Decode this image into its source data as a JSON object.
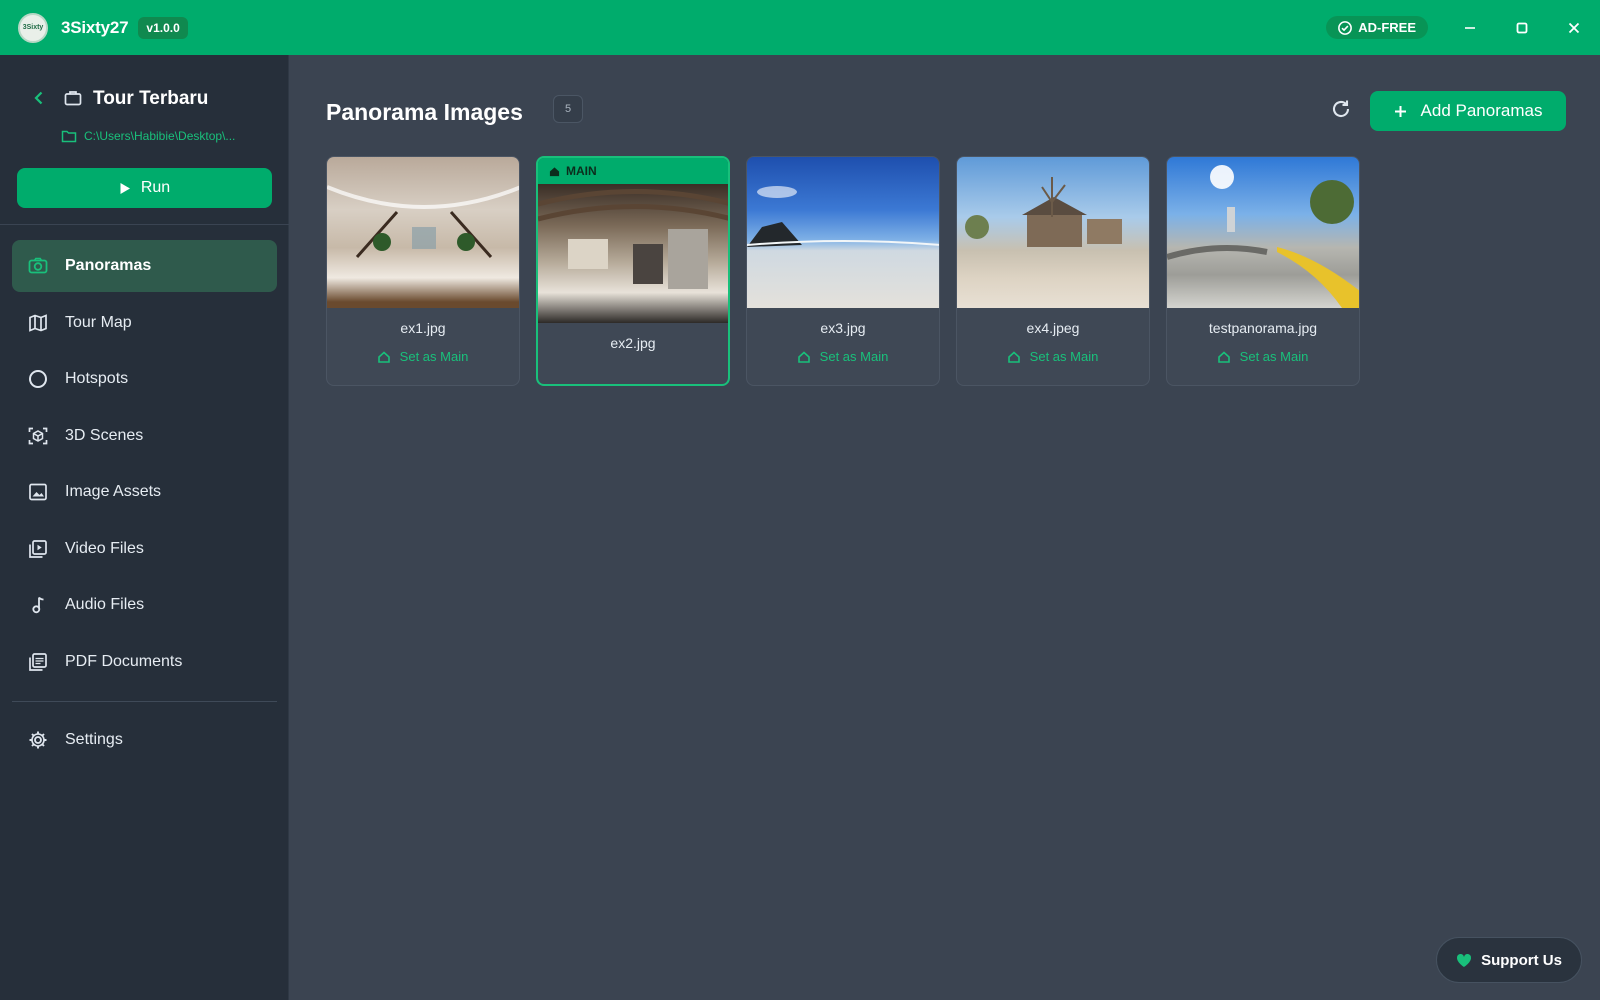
{
  "titlebar": {
    "app_name": "3Sixty27",
    "logo_text": "3Sixty",
    "version": "v1.0.0",
    "adfree_label": "AD-FREE"
  },
  "project": {
    "title": "Tour Terbaru",
    "path": "C:\\Users\\Habibie\\Desktop\\...",
    "run_label": "Run"
  },
  "nav": {
    "items": [
      {
        "label": "Panoramas",
        "icon": "camera-icon",
        "active": true
      },
      {
        "label": "Tour Map",
        "icon": "map-icon"
      },
      {
        "label": "Hotspots",
        "icon": "circle-icon"
      },
      {
        "label": "3D Scenes",
        "icon": "scan-3d-icon"
      },
      {
        "label": "Image Assets",
        "icon": "image-icon"
      },
      {
        "label": "Video Files",
        "icon": "video-icon"
      },
      {
        "label": "Audio Files",
        "icon": "music-note-icon"
      },
      {
        "label": "PDF Documents",
        "icon": "pdf-icon"
      }
    ],
    "settings_label": "Settings"
  },
  "main": {
    "title": "Panorama Images",
    "count": "5",
    "add_label": "Add Panoramas",
    "main_ribbon": "MAIN",
    "set_main_label": "Set as Main",
    "cards": [
      {
        "filename": "ex1.jpg"
      },
      {
        "filename": "ex2.jpg"
      },
      {
        "filename": "ex3.jpg"
      },
      {
        "filename": "ex4.jpeg"
      },
      {
        "filename": "testpanorama.jpg"
      }
    ]
  },
  "support_label": "Support Us",
  "colors": {
    "accent": "#00ac6c",
    "accent_text": "#19c07b",
    "sidebar_bg": "#262f3a",
    "main_bg": "#3b4451"
  }
}
